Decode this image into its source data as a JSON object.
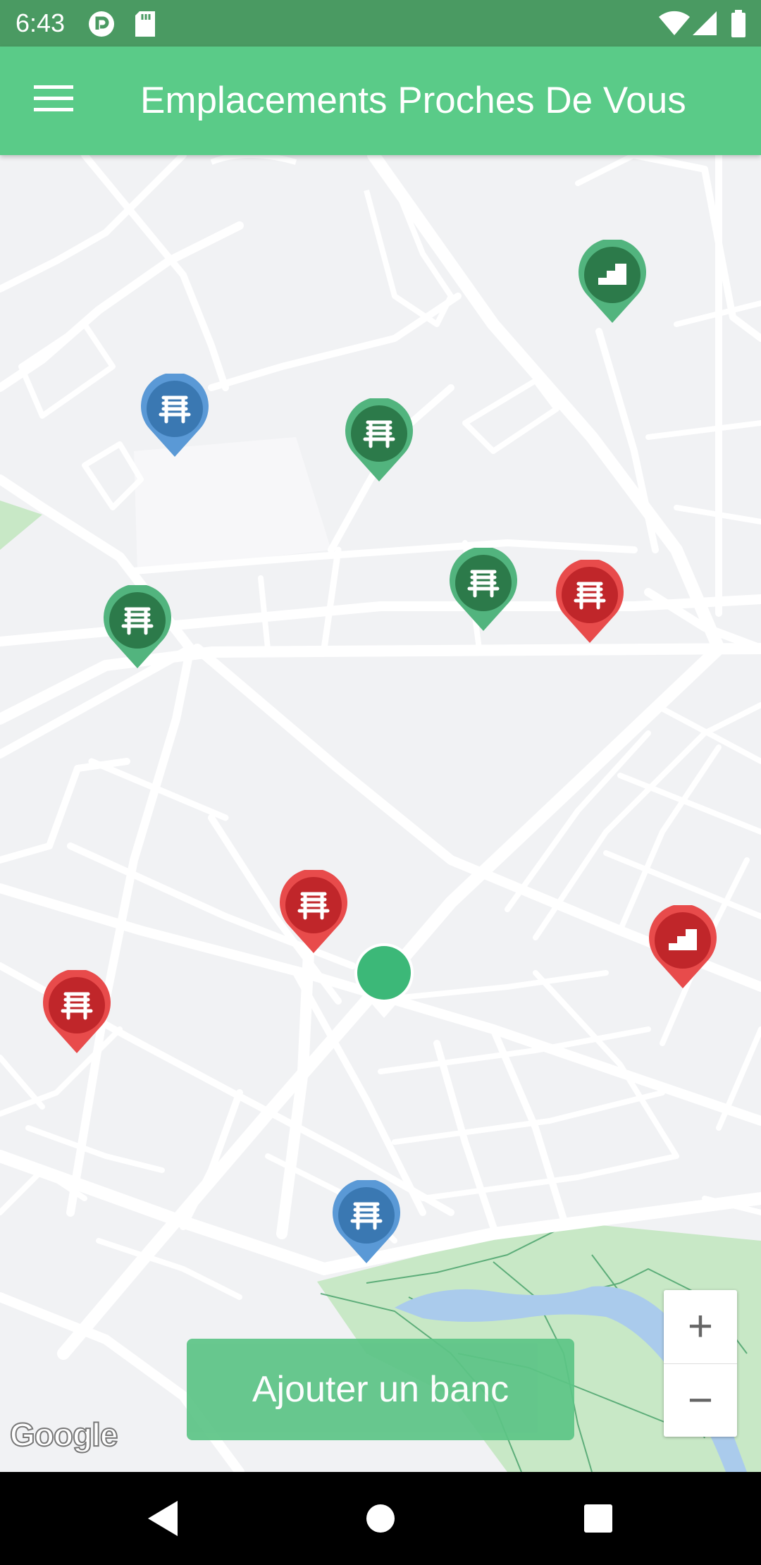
{
  "status_bar": {
    "time": "6:43"
  },
  "app_bar": {
    "title": "Emplacements Proches De Vous"
  },
  "map": {
    "attribution": "Google"
  },
  "zoom": {
    "in_label": "+",
    "out_label": "−"
  },
  "add_button": {
    "label": "Ajouter un banc"
  },
  "colors": {
    "primary": "#5acb88",
    "status_bar": "#4a9a62",
    "pin_green": "#3f9c67",
    "pin_blue": "#4a8ac6",
    "pin_red": "#d42d2d",
    "user_location": "#3cb878"
  },
  "markers": [
    {
      "type": "steps",
      "status": "green"
    },
    {
      "type": "bench",
      "status": "blue"
    },
    {
      "type": "bench",
      "status": "green"
    },
    {
      "type": "bench",
      "status": "green"
    },
    {
      "type": "bench",
      "status": "red"
    },
    {
      "type": "bench",
      "status": "green"
    },
    {
      "type": "bench",
      "status": "red"
    },
    {
      "type": "steps",
      "status": "red"
    },
    {
      "type": "bench",
      "status": "red"
    },
    {
      "type": "bench",
      "status": "blue"
    }
  ]
}
